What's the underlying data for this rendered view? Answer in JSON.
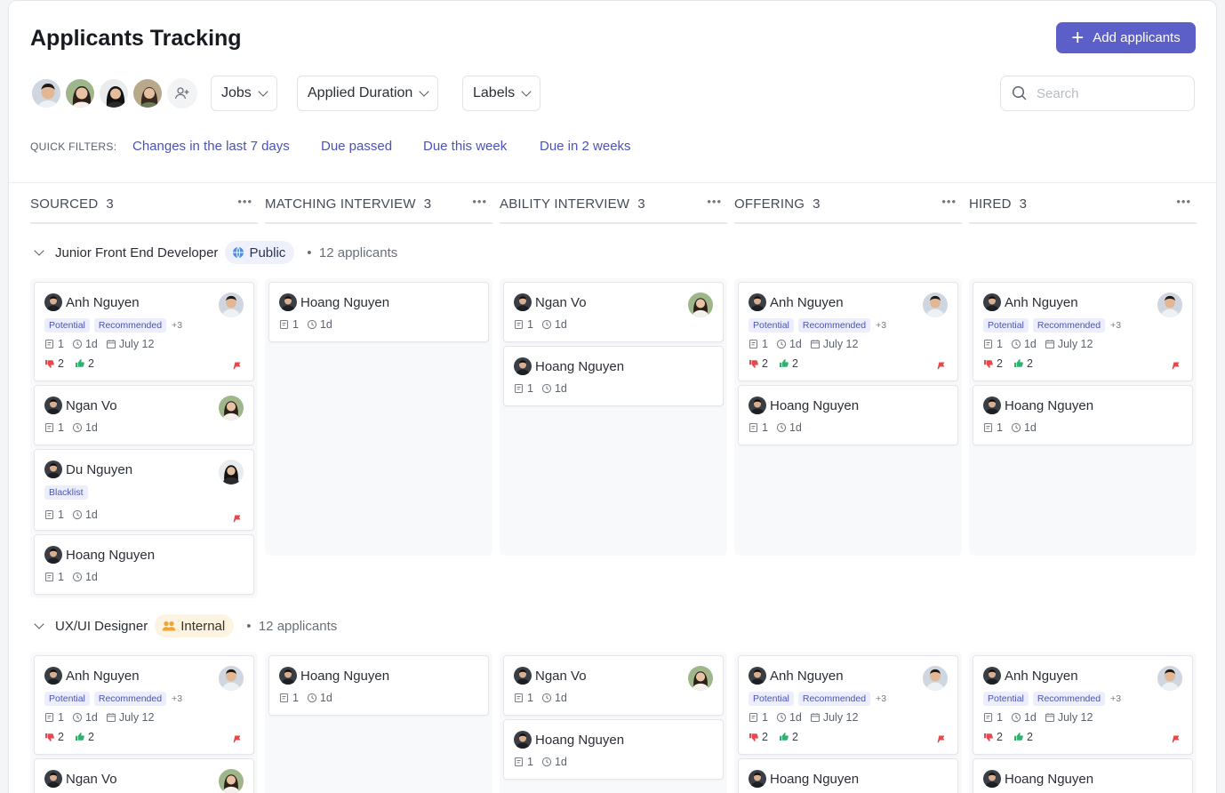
{
  "header": {
    "title": "Applicants Tracking",
    "add_button": "Add applicants"
  },
  "team": [
    "avatar-man",
    "avatar-woman",
    "avatar-woman-dark",
    "avatar-woman-outdoor"
  ],
  "filters": {
    "jobs": "Jobs",
    "applied_duration": "Applied Duration",
    "labels": "Labels",
    "search_placeholder": "Search"
  },
  "quick_filters": {
    "label": "QUICK FILTERS:",
    "items": [
      "Changes in the last 7 days",
      "Due passed",
      "Due this week",
      "Due in 2 weeks"
    ]
  },
  "columns": [
    {
      "name": "SOURCED",
      "count": "3"
    },
    {
      "name": "MATCHING INTERVIEW",
      "count": "3"
    },
    {
      "name": "ABILITY INTERVIEW",
      "count": "3"
    },
    {
      "name": "OFFERING",
      "count": "3"
    },
    {
      "name": "HIRED",
      "count": "3"
    }
  ],
  "groups": [
    {
      "title": "Junior Front End Developer",
      "badge": "Public",
      "applicants": "12 applicants"
    },
    {
      "title": "UX/UI Designer",
      "badge": "Internal",
      "applicants": "12 applicants"
    }
  ],
  "cards": {
    "anh": {
      "name": "Anh Nguyen",
      "tags": [
        "Potential",
        "Recommended"
      ],
      "more": "+3",
      "notes": "1",
      "age": "1d",
      "date": "July 12",
      "down": "2",
      "up": "2"
    },
    "ngan": {
      "name": "Ngan Vo",
      "notes": "1",
      "age": "1d"
    },
    "du": {
      "name": "Du Nguyen",
      "tags": [
        "Blacklist"
      ],
      "notes": "1",
      "age": "1d"
    },
    "hoang": {
      "name": "Hoang Nguyen",
      "notes": "1",
      "age": "1d"
    }
  },
  "colors": {
    "accent": "#5b5fc7",
    "link": "#4a53b8",
    "thumb_down": "#e5484d",
    "thumb_up": "#2fb170"
  }
}
